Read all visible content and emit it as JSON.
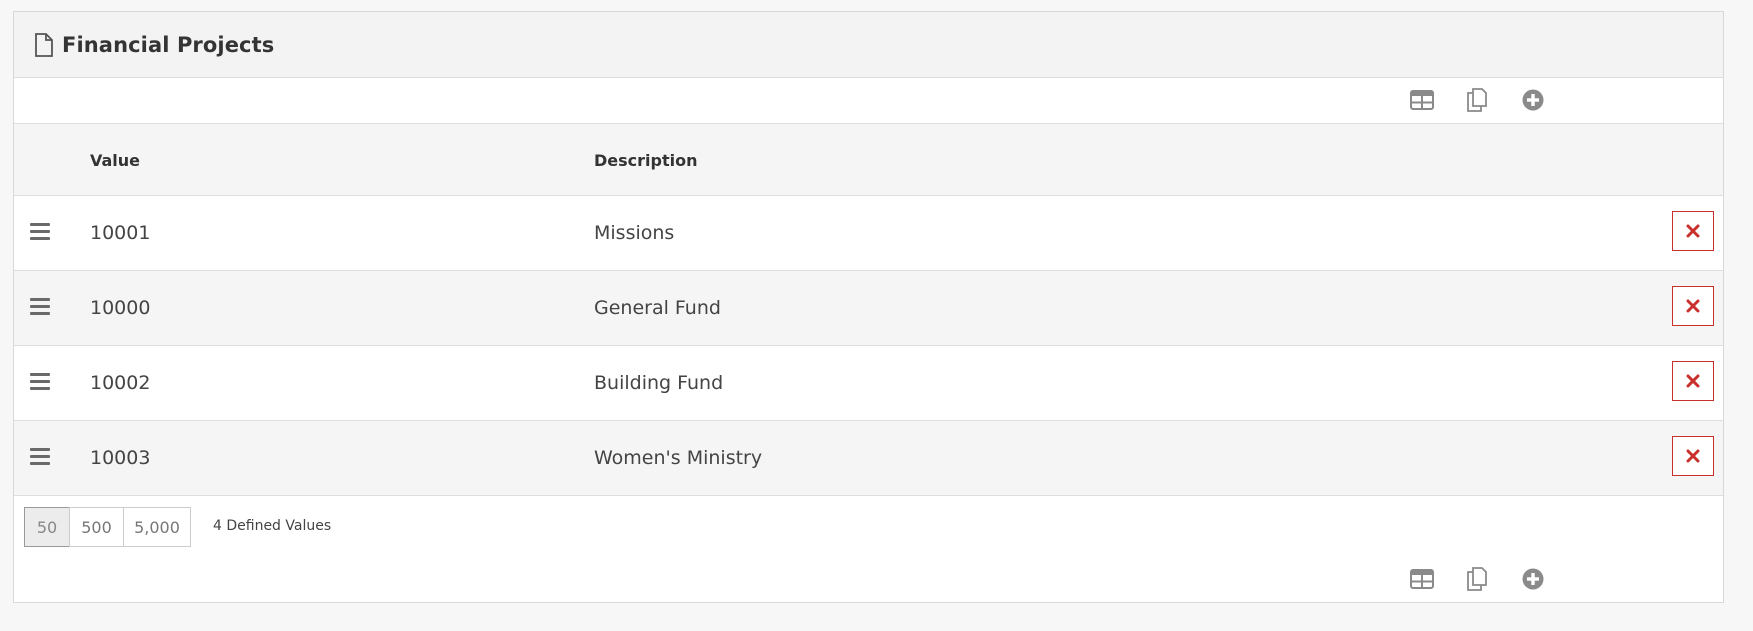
{
  "panel": {
    "title": "Financial Projects",
    "title_icon": "document-icon"
  },
  "toolbar": {
    "icons": [
      "grid-export-icon",
      "copy-icon",
      "add-circle-icon"
    ]
  },
  "table": {
    "columns": [
      "Value",
      "Description"
    ],
    "rows": [
      {
        "value": "10001",
        "description": "Missions"
      },
      {
        "value": "10000",
        "description": "General Fund"
      },
      {
        "value": "10002",
        "description": "Building Fund"
      },
      {
        "value": "10003",
        "description": "Women's Ministry"
      }
    ]
  },
  "footer": {
    "page_sizes": [
      "50",
      "500",
      "5,000"
    ],
    "active_page_size": "50",
    "count_label": "4 Defined Values"
  },
  "colors": {
    "danger": "#c9302c",
    "icon_gray": "#8a8a8a",
    "header_bg": "#f3f3f3"
  }
}
